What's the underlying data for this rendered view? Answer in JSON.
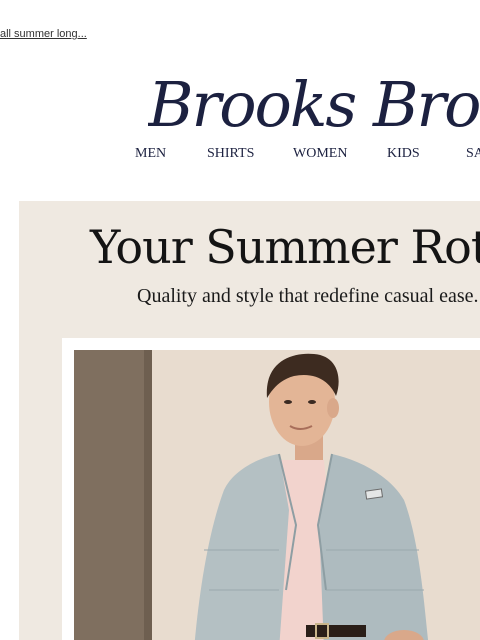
{
  "preheader": {
    "text": "all summer long..."
  },
  "brand": {
    "name": "Brooks Brothers",
    "color": "#1c2140"
  },
  "nav": {
    "items": [
      "MEN",
      "SHIRTS",
      "WOMEN",
      "KIDS",
      "SA"
    ]
  },
  "hero": {
    "title": "Your Summer Rotat",
    "subtitle": "Quality and style that redefine casual ease.",
    "background": "#efe9e1"
  }
}
